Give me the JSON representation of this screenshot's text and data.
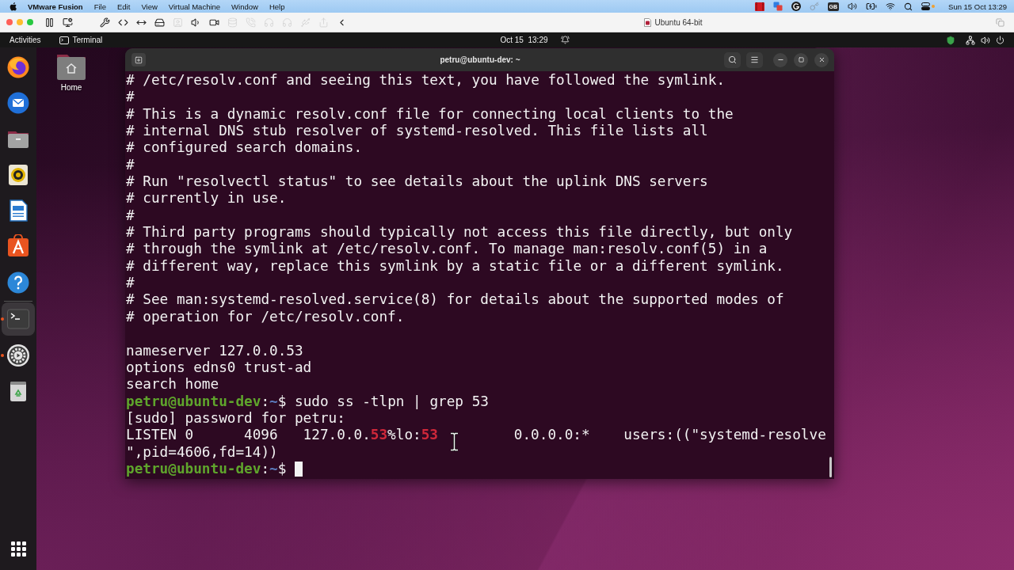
{
  "menu_bar": {
    "app_name": "VMware Fusion",
    "menus": [
      "File",
      "Edit",
      "View",
      "Virtual Machine",
      "Window",
      "Help"
    ],
    "input_source": "GB",
    "clock": "Sun 15 Oct 13:29"
  },
  "vm_toolbar": {
    "tools": [
      {
        "kind": "pause",
        "disabled": false
      },
      {
        "kind": "snapshot",
        "disabled": false
      },
      {
        "kind": "settings",
        "disabled": false
      },
      {
        "kind": "unity",
        "disabled": false
      },
      {
        "kind": "fit",
        "disabled": false
      },
      {
        "kind": "drive",
        "disabled": false
      },
      {
        "kind": "webcam",
        "disabled": true
      },
      {
        "kind": "sound",
        "disabled": false
      },
      {
        "kind": "camera",
        "disabled": false
      },
      {
        "kind": "storage",
        "disabled": true
      },
      {
        "kind": "phone",
        "disabled": true
      },
      {
        "kind": "headphones",
        "disabled": true
      },
      {
        "kind": "headset",
        "disabled": true
      },
      {
        "kind": "usb",
        "disabled": true
      },
      {
        "kind": "sharing",
        "disabled": true
      },
      {
        "kind": "chevron",
        "disabled": false
      }
    ],
    "vm_name": "Ubuntu 64-bit"
  },
  "top_bar": {
    "activities": "Activities",
    "app_menu": "Terminal",
    "clock": "Oct 15  13:29"
  },
  "dock": {
    "favorites": [
      {
        "kind": "browser",
        "running": false,
        "selected": false
      },
      {
        "kind": "mail",
        "running": false,
        "selected": false
      },
      {
        "kind": "files",
        "running": false,
        "selected": false
      },
      {
        "kind": "music",
        "running": false,
        "selected": false
      },
      {
        "kind": "writer",
        "running": false,
        "selected": false
      },
      {
        "kind": "store",
        "running": false,
        "selected": false
      },
      {
        "kind": "help",
        "running": false,
        "selected": false
      }
    ],
    "open": [
      {
        "kind": "terminal",
        "running": true,
        "selected": true
      },
      {
        "kind": "settings",
        "running": true,
        "selected": false
      },
      {
        "kind": "trash",
        "running": false,
        "selected": false
      }
    ]
  },
  "desktop": {
    "icons": [
      {
        "label": "Home"
      }
    ]
  },
  "terminal": {
    "title": "petru@ubuntu-dev: ~",
    "lines": [
      {
        "kind": "text",
        "text": "# /etc/resolv.conf and seeing this text, you have followed the symlink."
      },
      {
        "kind": "text",
        "text": "#"
      },
      {
        "kind": "text",
        "text": "# This is a dynamic resolv.conf file for connecting local clients to the"
      },
      {
        "kind": "text",
        "text": "# internal DNS stub resolver of systemd-resolved. This file lists all"
      },
      {
        "kind": "text",
        "text": "# configured search domains."
      },
      {
        "kind": "text",
        "text": "#"
      },
      {
        "kind": "text",
        "text": "# Run \"resolvectl status\" to see details about the uplink DNS servers"
      },
      {
        "kind": "text",
        "text": "# currently in use."
      },
      {
        "kind": "text",
        "text": "#"
      },
      {
        "kind": "text",
        "text": "# Third party programs should typically not access this file directly, but only"
      },
      {
        "kind": "text",
        "text": "# through the symlink at /etc/resolv.conf. To manage man:resolv.conf(5) in a"
      },
      {
        "kind": "text",
        "text": "# different way, replace this symlink by a static file or a different symlink."
      },
      {
        "kind": "text",
        "text": "#"
      },
      {
        "kind": "text",
        "text": "# See man:systemd-resolved.service(8) for details about the supported modes of"
      },
      {
        "kind": "text",
        "text": "# operation for /etc/resolv.conf."
      },
      {
        "kind": "blank"
      },
      {
        "kind": "text",
        "text": "nameserver 127.0.0.53"
      },
      {
        "kind": "text",
        "text": "options edns0 trust-ad"
      },
      {
        "kind": "text",
        "text": "search home"
      },
      {
        "kind": "prompt",
        "user": "petru@ubuntu-dev",
        "separator": ":",
        "path": "~",
        "symbol": "$",
        "command": "sudo ss -tlpn | grep 53"
      },
      {
        "kind": "text",
        "text": "[sudo] password for petru:"
      },
      {
        "kind": "columns",
        "cells": [
          {
            "text": "LISTEN"
          },
          {
            "text": "0"
          },
          {
            "text": "4096"
          },
          {
            "segments": [
              {
                "kind": "plain",
                "text": "127.0.0."
              },
              {
                "kind": "match",
                "text": "53"
              },
              {
                "kind": "plain",
                "text": "%lo:"
              },
              {
                "kind": "match",
                "text": "53"
              }
            ]
          },
          {
            "text": "0.0.0.0:*"
          },
          {
            "text": "users:((\"systemd-resolve"
          }
        ]
      },
      {
        "kind": "text",
        "text": "\",pid=4606,fd=14))"
      },
      {
        "kind": "prompt",
        "user": "petru@ubuntu-dev",
        "separator": ":",
        "path": "~",
        "symbol": "$",
        "cursor": true
      }
    ]
  }
}
